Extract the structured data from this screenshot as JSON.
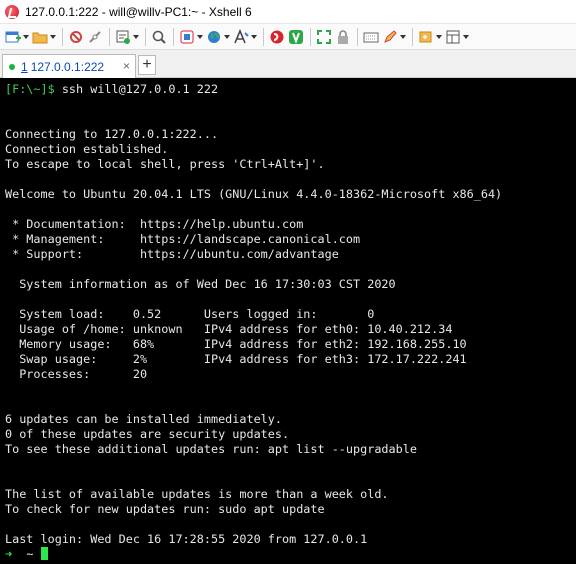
{
  "window": {
    "title": "127.0.0.1:222 - will@willv-PC1:~ - Xshell 6"
  },
  "toolbar": {
    "buttons": [
      {
        "name": "new-session-icon",
        "caret": true
      },
      {
        "name": "open-folder-icon",
        "caret": true
      },
      {
        "name": "reconnect-icon",
        "caret": false
      },
      {
        "name": "disconnect-icon",
        "caret": false
      },
      {
        "name": "properties-icon",
        "caret": true
      },
      {
        "name": "find-icon",
        "caret": false
      },
      {
        "name": "transfer-icon",
        "caret": true
      },
      {
        "name": "globe-icon",
        "caret": true
      },
      {
        "name": "font-icon",
        "caret": true
      },
      {
        "name": "xshell-logo-icon",
        "caret": false
      },
      {
        "name": "xftp-icon",
        "caret": false
      },
      {
        "name": "fullscreen-icon",
        "caret": false
      },
      {
        "name": "lock-icon",
        "caret": false
      },
      {
        "name": "keyboard-icon",
        "caret": false
      },
      {
        "name": "compose-icon",
        "caret": true
      },
      {
        "name": "add-tab-icon",
        "caret": true
      },
      {
        "name": "layout-icon",
        "caret": true
      }
    ]
  },
  "tabs": [
    {
      "number": "1",
      "label": "127.0.0.1:222",
      "close": "×"
    }
  ],
  "add_tab": "+",
  "terminal": {
    "lines": [
      {
        "prompt": "[F:\\~]$",
        "text": " ssh will@127.0.0.1 222"
      },
      {
        "text": ""
      },
      {
        "text": ""
      },
      {
        "text": "Connecting to 127.0.0.1:222..."
      },
      {
        "text": "Connection established."
      },
      {
        "text": "To escape to local shell, press 'Ctrl+Alt+]'."
      },
      {
        "text": ""
      },
      {
        "text": "Welcome to Ubuntu 20.04.1 LTS (GNU/Linux 4.4.0-18362-Microsoft x86_64)"
      },
      {
        "text": ""
      },
      {
        "text": " * Documentation:  https://help.ubuntu.com"
      },
      {
        "text": " * Management:     https://landscape.canonical.com"
      },
      {
        "text": " * Support:        https://ubuntu.com/advantage"
      },
      {
        "text": ""
      },
      {
        "text": "  System information as of Wed Dec 16 17:30:03 CST 2020"
      },
      {
        "text": ""
      },
      {
        "text": "  System load:    0.52      Users logged in:       0"
      },
      {
        "text": "  Usage of /home: unknown   IPv4 address for eth0: 10.40.212.34"
      },
      {
        "text": "  Memory usage:   68%       IPv4 address for eth2: 192.168.255.10"
      },
      {
        "text": "  Swap usage:     2%        IPv4 address for eth3: 172.17.222.241"
      },
      {
        "text": "  Processes:      20"
      },
      {
        "text": ""
      },
      {
        "text": ""
      },
      {
        "text": "6 updates can be installed immediately."
      },
      {
        "text": "0 of these updates are security updates."
      },
      {
        "text": "To see these additional updates run: apt list --upgradable"
      },
      {
        "text": ""
      },
      {
        "text": ""
      },
      {
        "text": "The list of available updates is more than a week old."
      },
      {
        "text": "To check for new updates run: sudo apt update"
      },
      {
        "text": ""
      },
      {
        "text": "Last login: Wed Dec 16 17:28:55 2020 from 127.0.0.1"
      }
    ],
    "shell_prompt": {
      "arrow": "➜",
      "dir": "  ~ "
    }
  },
  "colors": {
    "prompt": "#39d353",
    "cursor": "#2ee84b",
    "terminal_bg": "#000000",
    "terminal_fg": "#e8e8e8",
    "tab_text": "#0a4ab5"
  }
}
